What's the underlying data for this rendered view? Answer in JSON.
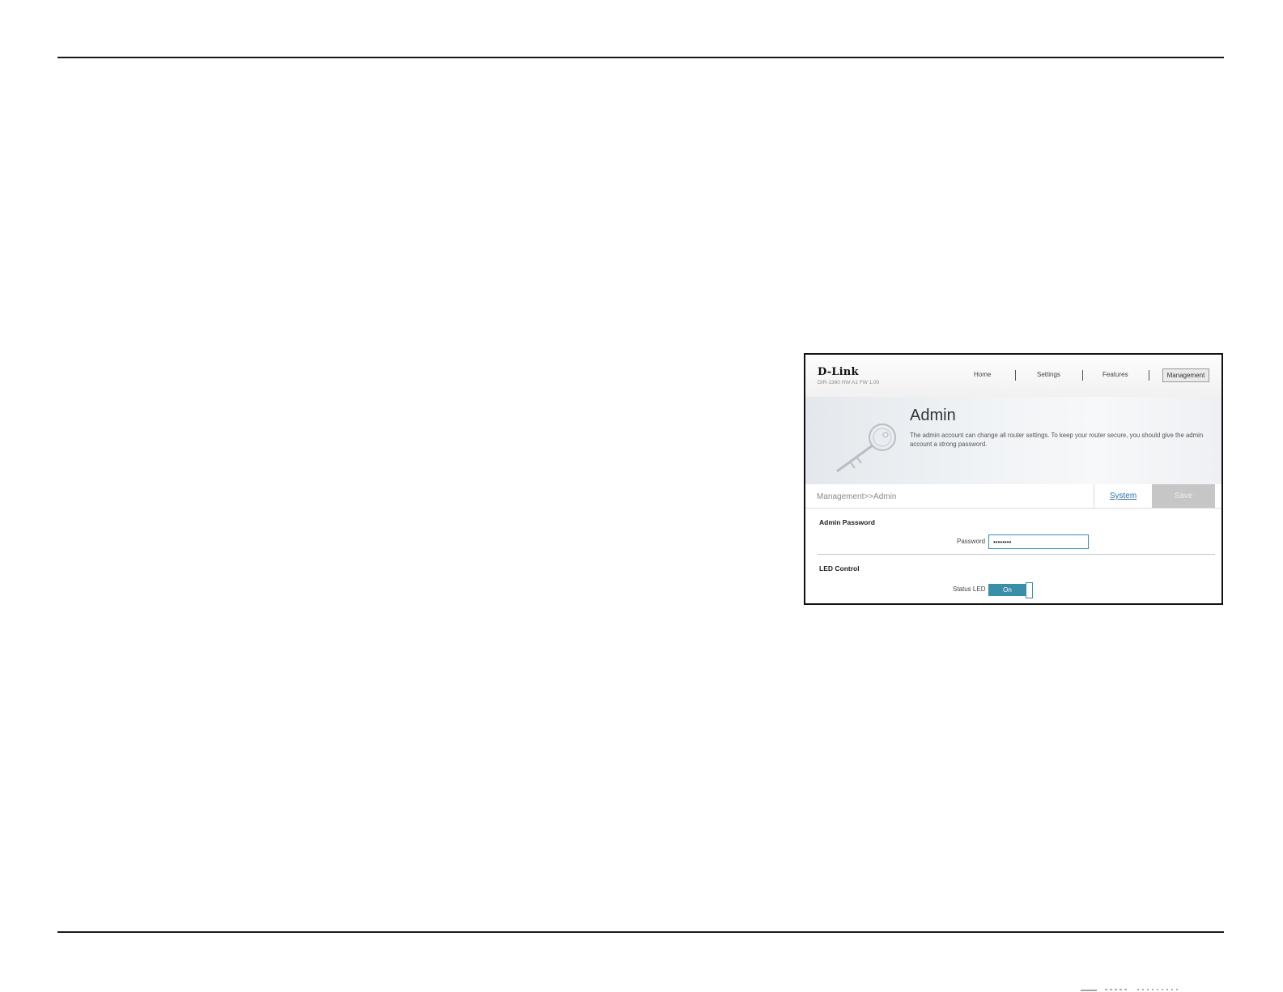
{
  "router_ui": {
    "brand": "D-Link",
    "model": "DIR-1360 HW A1 FW 1.00",
    "nav": {
      "home": "Home",
      "settings": "Settings",
      "features": "Features",
      "management": "Management"
    },
    "page_title": "Admin",
    "description": "The admin account can change all router settings. To keep your router secure, you should give the admin account a strong password.",
    "breadcrumb": "Management>>Admin",
    "system_button": "System",
    "save_button": "Save",
    "admin_password": {
      "section_title": "Admin Password",
      "label": "Password",
      "value": "••••••••"
    },
    "led_control": {
      "section_title": "LED Control",
      "label": "Status LED",
      "toggle_state": "On"
    },
    "colors": {
      "toggle_accent": "#3b8ea8",
      "link": "#2a6ea8",
      "save_disabled": "#c6c6c6"
    }
  }
}
